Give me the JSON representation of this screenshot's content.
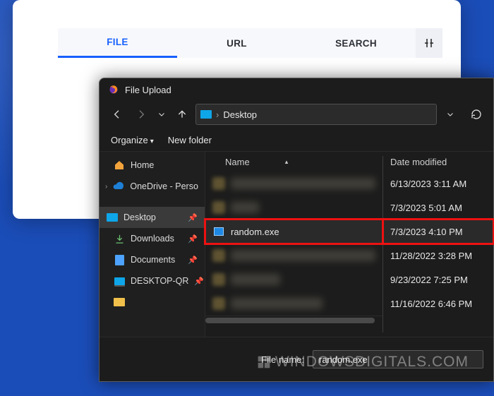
{
  "tabs": {
    "file": "FILE",
    "url": "URL",
    "search": "SEARCH"
  },
  "dialog": {
    "title": "File Upload",
    "breadcrumb": {
      "location": "Desktop"
    },
    "toolbar": {
      "organize": "Organize",
      "newfolder": "New folder"
    },
    "sidebar": {
      "home": "Home",
      "onedrive": "OneDrive - Perso",
      "desktop": "Desktop",
      "downloads": "Downloads",
      "documents": "Documents",
      "desktopqr": "DESKTOP-QR"
    },
    "columns": {
      "name": "Name",
      "date": "Date modified"
    },
    "rows": [
      {
        "name": "",
        "date": "6/13/2023 3:11 AM",
        "blurred": true
      },
      {
        "name": "",
        "date": "7/3/2023 5:01 AM",
        "blurred": true
      },
      {
        "name": "random.exe",
        "date": "7/3/2023 4:10 PM",
        "blurred": false,
        "selected": true
      },
      {
        "name": "",
        "date": "11/28/2022 3:28 PM",
        "blurred": true
      },
      {
        "name": "",
        "date": "9/23/2022 7:25 PM",
        "blurred": true
      },
      {
        "name": "",
        "date": "11/16/2022 6:46 PM",
        "blurred": true
      }
    ],
    "footer": {
      "label": "File name:",
      "value": "random.exe"
    }
  },
  "watermark": "WINDOWSDIGITALS.COM"
}
